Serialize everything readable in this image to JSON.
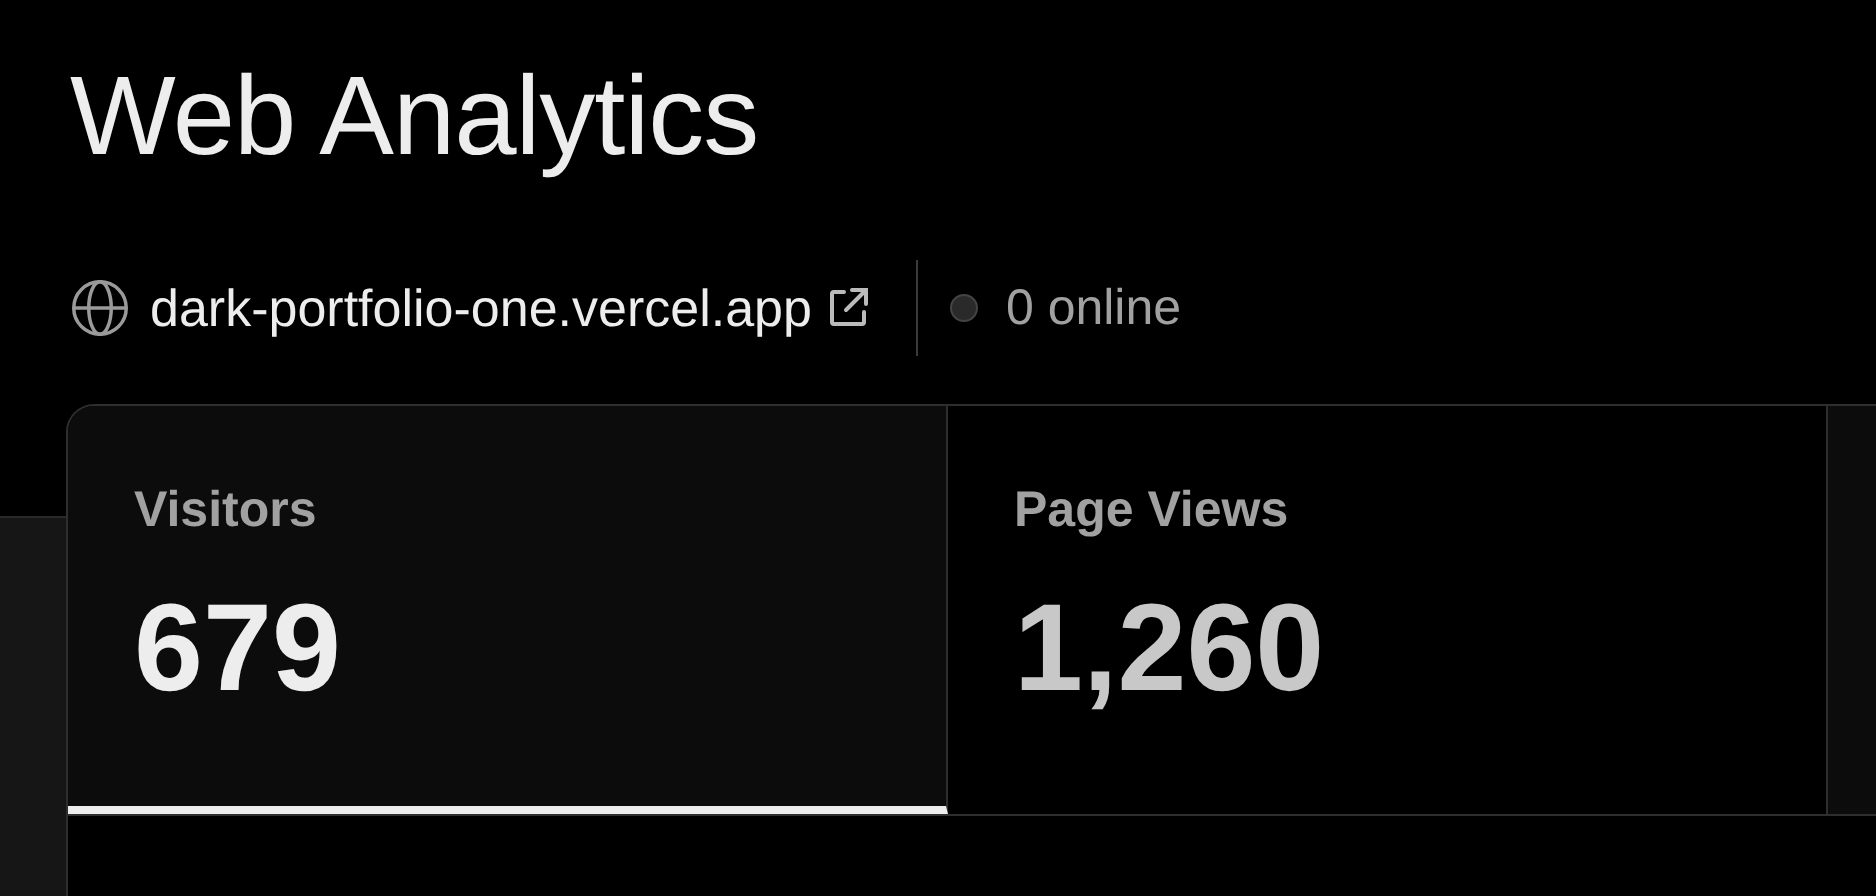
{
  "title": "Web Analytics",
  "site": {
    "domain": "dark-portfolio-one.vercel.app",
    "online": "0 online"
  },
  "tabs": [
    {
      "label": "Visitors",
      "value": "679",
      "selected": true
    },
    {
      "label": "Page Views",
      "value": "1,260",
      "selected": false
    }
  ]
}
